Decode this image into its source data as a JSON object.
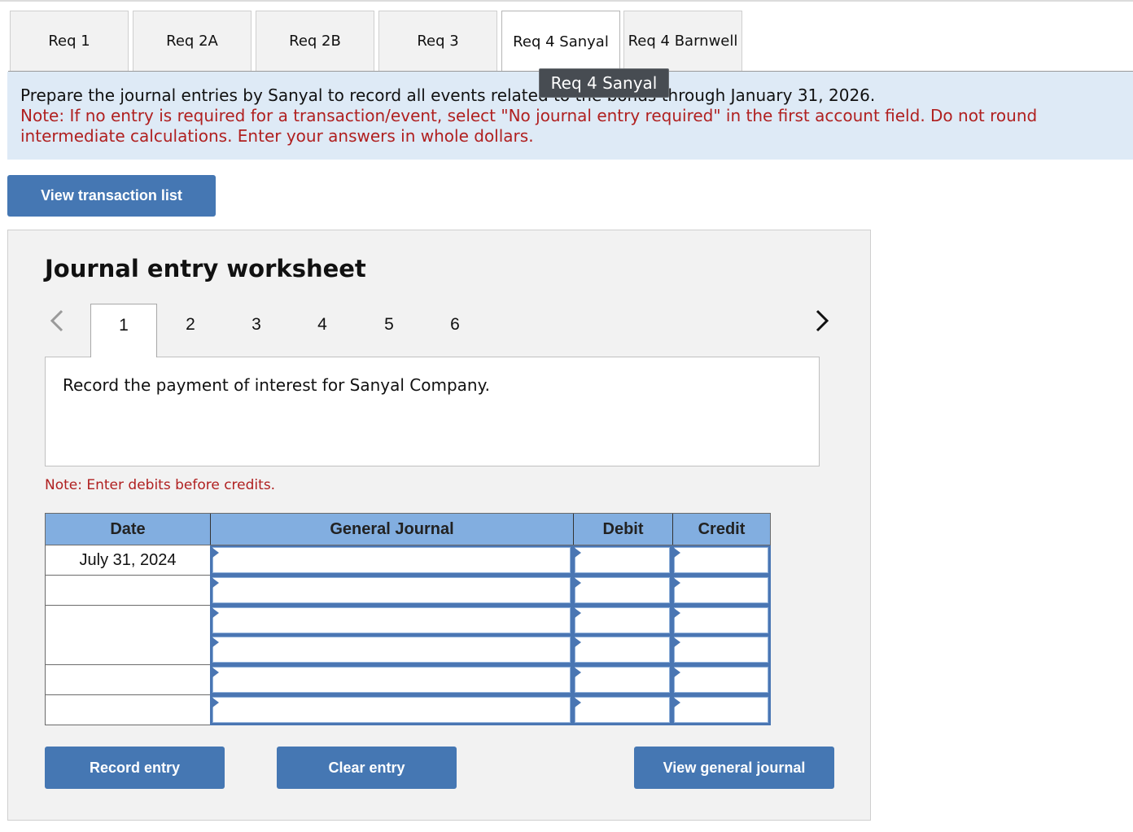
{
  "req_tabs": [
    {
      "label": "Req 1",
      "active": false
    },
    {
      "label": "Req 2A",
      "active": false
    },
    {
      "label": "Req 2B",
      "active": false
    },
    {
      "label": "Req 3",
      "active": false
    },
    {
      "label": "Req 4 Sanyal",
      "active": true
    },
    {
      "label": "Req 4 Barnwell",
      "active": false
    }
  ],
  "tooltip": "Req 4 Sanyal",
  "instructions": {
    "main": "Prepare the journal entries by Sanyal to record all events related to the bonds through January 31, 2026.",
    "note": "Note: If no entry is required for a transaction/event, select \"No journal entry required\" in the first account field. Do not round intermediate calculations. Enter your answers in whole dollars."
  },
  "buttons": {
    "view_transaction_list": "View transaction list",
    "record_entry": "Record entry",
    "clear_entry": "Clear entry",
    "view_general_journal": "View general journal"
  },
  "worksheet": {
    "title": "Journal entry worksheet",
    "entry_tabs": [
      "1",
      "2",
      "3",
      "4",
      "5",
      "6"
    ],
    "active_entry": "1",
    "description": "Record the payment of interest for Sanyal Company.",
    "debits_note": "Note: Enter debits before credits."
  },
  "journal_table": {
    "headers": {
      "date": "Date",
      "general_journal": "General Journal",
      "debit": "Debit",
      "credit": "Credit"
    },
    "rows": [
      {
        "date": "July 31, 2024",
        "account": "",
        "debit": "",
        "credit": ""
      },
      {
        "date": "",
        "account": "",
        "debit": "",
        "credit": ""
      },
      {
        "date": "",
        "account": "",
        "debit": "",
        "credit": ""
      },
      {
        "date": "",
        "account": "",
        "debit": "",
        "credit": ""
      },
      {
        "date": "",
        "account": "",
        "debit": "",
        "credit": ""
      },
      {
        "date": "",
        "account": "",
        "debit": "",
        "credit": ""
      }
    ]
  },
  "colors": {
    "button_blue": "#4577b3",
    "header_blue": "#82aee0",
    "instruction_band": "#deeaf6",
    "note_red": "#b02020"
  }
}
